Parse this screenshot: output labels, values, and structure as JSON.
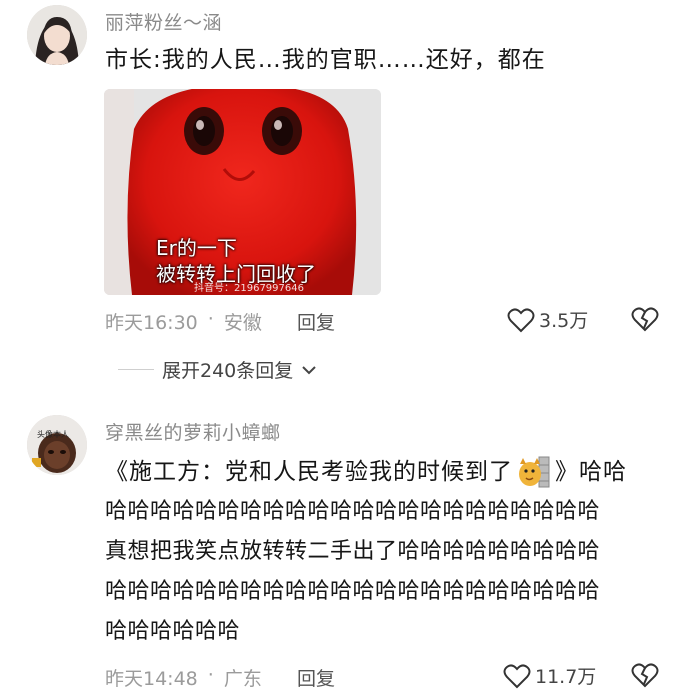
{
  "comment1": {
    "username": "丽萍粉丝～涵",
    "text": "市长:我的人民…我的官职……还好，都在",
    "media_caption_line1": "Er的一下",
    "media_caption_line2": "被转转上门回收了",
    "media_watermark": "抖音号：21967997646",
    "time": "昨天16:30",
    "location": "安徽",
    "reply_label": "回复",
    "likes": "3.5万"
  },
  "expand_replies": "展开240条回复",
  "comment2": {
    "username": "穿黑丝的萝莉小蟑螂",
    "avatar_text": "头像本人",
    "text_lines": [
      "《施工方：党和人民考验我的时候到了",
      "》哈哈",
      "哈哈哈哈哈哈哈哈哈哈哈哈哈哈哈哈哈哈哈哈哈哈",
      "真想把我笑点放转转二手出了哈哈哈哈哈哈哈哈哈",
      "哈哈哈哈哈哈哈哈哈哈哈哈哈哈哈哈哈哈哈哈哈哈",
      "哈哈哈哈哈哈"
    ],
    "time": "昨天14:48",
    "location": "广东",
    "reply_label": "回复",
    "likes": "11.7万"
  },
  "separator": "·",
  "colors": {
    "meme_red": "#e8150f",
    "meta_gray": "#9b9b9b"
  }
}
